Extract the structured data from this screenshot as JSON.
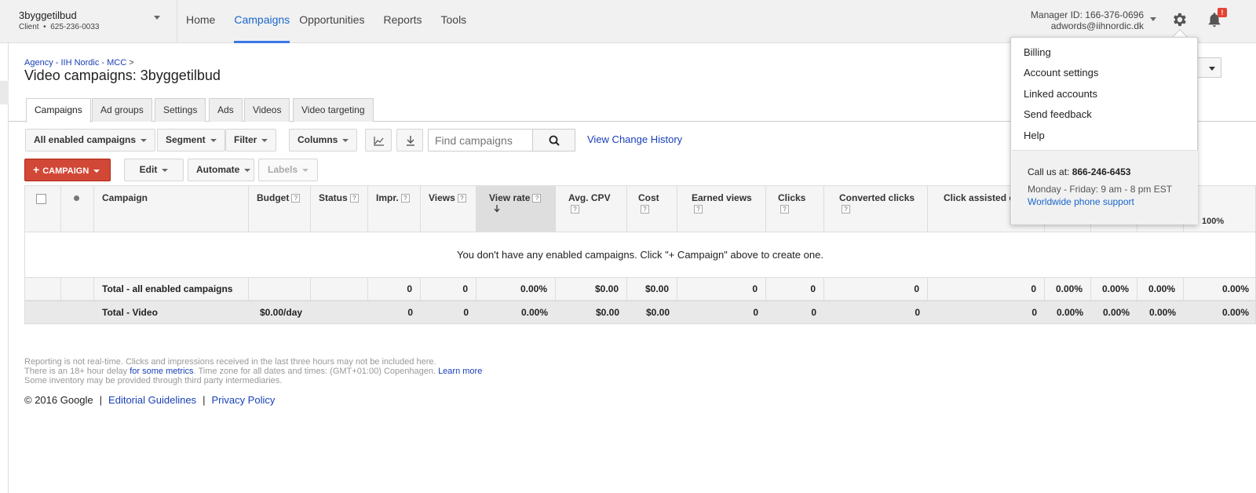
{
  "account": {
    "name": "3byggetilbud",
    "type": "Client",
    "bullet": "•",
    "id": "625-236-0033"
  },
  "nav": {
    "home": "Home",
    "campaigns": "Campaigns",
    "opportunities": "Opportunities",
    "reports": "Reports",
    "tools": "Tools"
  },
  "manager": {
    "id_line": "Manager ID: 166-376-0696",
    "email": "adwords@iihnordic.dk"
  },
  "notifications": {
    "badge": "!"
  },
  "breadcrumb": {
    "agency": "Agency - IIH Nordic - MCC",
    "sep": ">"
  },
  "page_title": "Video campaigns: 3byggetilbud",
  "tabs": [
    "Campaigns",
    "Ad groups",
    "Settings",
    "Ads",
    "Videos",
    "Video targeting"
  ],
  "toolbar": {
    "filter_scope": "All enabled campaigns",
    "segment": "Segment",
    "filter": "Filter",
    "columns": "Columns",
    "search_placeholder": "Find campaigns",
    "view_history": "View Change History",
    "campaign_plus": "+",
    "campaign": "Campaign",
    "edit": "Edit",
    "automate": "Automate",
    "labels": "Labels"
  },
  "table": {
    "headers": {
      "campaign": "Campaign",
      "budget": "Budget",
      "status": "Status",
      "impr": "Impr.",
      "views": "Views",
      "view_rate": "View rate",
      "avg_cpv": "Avg. CPV",
      "cost": "Cost",
      "earned_views": "Earned views",
      "clicks": "Clicks",
      "converted_clicks": "Converted clicks",
      "click_assisted": "Click assisted co"
    },
    "help": "?",
    "empty_message": "You don't have any enabled campaigns. Click \"+ Campaign\" above to create one.",
    "partial_pct": "100%",
    "total_enabled": {
      "label": "Total - all enabled campaigns",
      "impr": "0",
      "views": "0",
      "view_rate": "0.00%",
      "avg_cpv": "$0.00",
      "cost": "$0.00",
      "earned_views": "0",
      "clicks": "0",
      "converted_clicks": "0",
      "click_assisted": "0",
      "p1": "0.00%",
      "p2": "0.00%",
      "p3": "0.00%",
      "p4": "0.00%"
    },
    "total_video": {
      "label": "Total - Video",
      "budget": "$0.00/day",
      "impr": "0",
      "views": "0",
      "view_rate": "0.00%",
      "avg_cpv": "$0.00",
      "cost": "$0.00",
      "earned_views": "0",
      "clicks": "0",
      "converted_clicks": "0",
      "click_assisted": "0",
      "p1": "0.00%",
      "p2": "0.00%",
      "p3": "0.00%",
      "p4": "0.00%"
    }
  },
  "footer": {
    "note1": "Reporting is not real-time. Clicks and impressions received in the last three hours may not be included here.",
    "note2a": "There is an 18+ hour delay",
    "note2_link": "for some metrics",
    "note2b": ". Time zone for all dates and times: (GMT+01:00) Copenhagen.",
    "learn_more": "Learn more",
    "note3": "Some inventory may be provided through third party intermediaries.",
    "copyright": "© 2016 Google",
    "pipe": "|",
    "editorial": "Editorial Guidelines",
    "privacy": "Privacy Policy"
  },
  "settings_menu": {
    "items": [
      "Billing",
      "Account settings",
      "Linked accounts",
      "Send feedback",
      "Help"
    ],
    "call_label": "Call us at:",
    "phone": "866-246-6453",
    "hours": "Monday - Friday: 9 am - 8 pm EST",
    "support_link": "Worldwide phone support"
  },
  "colors": {
    "accent_blue": "#1a66cc",
    "link_blue": "#1a40b8",
    "campaign_red": "#d14836",
    "badge_red": "#e34234"
  }
}
